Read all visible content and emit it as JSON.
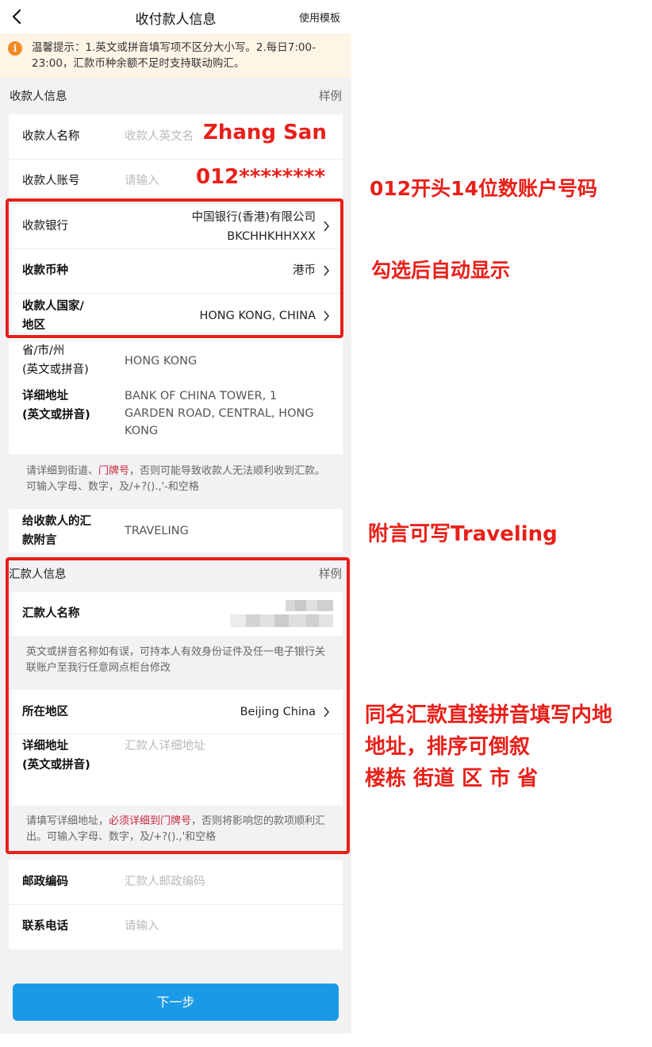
{
  "nav": {
    "title": "收付款人信息",
    "template_label": "使用模板"
  },
  "notice": {
    "text": "温馨提示：1.英文或拼音填写项不区分大小写。2.每日7:00-23:00，汇款币种余额不足时支持联动购汇。"
  },
  "payee_section": {
    "title": "收款人信息",
    "example": "样例",
    "name_label": "收款人名称",
    "name_placeholder": "收款人英文名",
    "name_value": "Zhang San",
    "account_label": "收款人账号",
    "account_placeholder": "请输入",
    "account_value": "012********",
    "bank_label": "收款银行",
    "bank_name": "中国银行(香港)有限公司",
    "bank_swift": "BKCHHKHHXXX",
    "currency_label": "收款币种",
    "currency_value": "港币",
    "country_label_1": "收款人国家/",
    "country_label_2": "地区",
    "country_value": "HONG KONG, CHINA",
    "province_label_1": "省/市/州",
    "province_label_2": "(英文或拼音)",
    "province_value": "HONG KONG",
    "address_label_1": "详细地址",
    "address_label_2": "(英文或拼音)",
    "address_line1": "BANK OF CHINA TOWER, 1",
    "address_line2": "GARDEN ROAD, CENTRAL, HONG",
    "address_line3": "KONG",
    "hint_pre": "请详细到街道、",
    "hint_red": "门牌号",
    "hint_post": "，否则可能导致收款人无法顺利收到汇款。可输入字母、数字，及/+?().,'-和空格",
    "postscript_label_1": "给收款人的汇",
    "postscript_label_2": "款附言",
    "postscript_value": "TRAVELING"
  },
  "remitter_section": {
    "title": "汇款人信息",
    "example": "样例",
    "name_label": "汇款人名称",
    "name_hint": "英文或拼音名称如有误，可持本人有效身份证件及任一电子银行关联账户至我行任意网点柜台修改",
    "region_label": "所在地区",
    "region_value": "Beijing China",
    "address_label_1": "详细地址",
    "address_label_2": "(英文或拼音)",
    "address_placeholder": "汇款人详细地址",
    "addr_hint_pre": "请填写详细地址，",
    "addr_hint_red": "必须详细到门牌号",
    "addr_hint_post": "，否则将影响您的款项顺利汇出。可输入字母、数字，及/+?().,'和空格",
    "postal_label": "邮政编码",
    "postal_placeholder": "汇款人邮政编码",
    "phone_label": "联系电话",
    "phone_placeholder": "请输入"
  },
  "next_button": "下一步",
  "annotations": {
    "account_note": "012开头14位数账户号码",
    "auto_note": "勾选后自动显示",
    "postscript_note": "附言可写Traveling",
    "address_note_1": "同名汇款直接拼音填写内地",
    "address_note_2": "地址，排序可倒叙",
    "address_note_3": "楼栋 街道 区 市 省"
  },
  "colors": {
    "accent": "#1a9ae6",
    "annotation": "#e8201a",
    "notice_bg": "#fff5e6",
    "notice_icon": "#f08a24"
  }
}
